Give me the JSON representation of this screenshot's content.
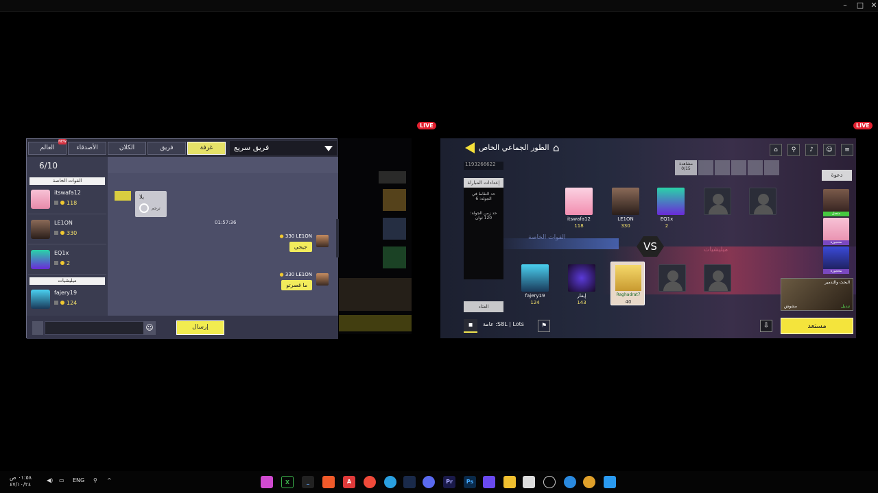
{
  "live_badge": "LIVE",
  "left": {
    "tabs": [
      "العالم",
      "الأصدقاء",
      "الكلان",
      "فريق",
      "غرفة"
    ],
    "active_tab": "غرفة",
    "mode_dropdown": "فريق سريع",
    "player_count": "6/10",
    "teams": [
      {
        "name": "القوات الخاصة",
        "players": [
          {
            "name": "itswafa12",
            "level": "118"
          },
          {
            "name": "LE1ON",
            "level": "330"
          },
          {
            "name": "EQ1x",
            "level": "2"
          }
        ]
      },
      {
        "name": "ميليشيات",
        "players": [
          {
            "name": "fajery19",
            "level": "124"
          }
        ]
      }
    ],
    "system_msg": {
      "text": "يلا",
      "sub": "ترجم"
    },
    "timestamp": "01:57:36",
    "messages": [
      {
        "author": "LE1ON",
        "level": "330",
        "text": "جيجي"
      },
      {
        "author": "LE1ON",
        "level": "330",
        "text": "ما قصرتو"
      }
    ],
    "send_label": "إرسال"
  },
  "right": {
    "title": "الطور الجماعي الخاص",
    "room_id": "1193266622",
    "settings_label": "إعدادات المباراة",
    "settings_items": [
      "حد النقاط في الجولة: 6",
      "حد زمن الجولة: 120 ثوان"
    ],
    "spectators_label": "مشاهدة",
    "spectators_count": "0/15",
    "invite_label": "دعوة",
    "invite_tags": [
      "متصل",
      "محجوزة",
      "محجوزة"
    ],
    "team1_label": "القوات الخاصة",
    "team2_label": "ميليشيات",
    "vs": "VS",
    "team1": [
      {
        "name": "itswafa12",
        "level": "118"
      },
      {
        "name": "LE1ON",
        "level": "330"
      },
      {
        "name": "EQ1x",
        "level": "2"
      }
    ],
    "team2": [
      {
        "name": "fajery19",
        "level": "124"
      },
      {
        "name": "إيفار",
        "level": "143"
      },
      {
        "name": "Raghadrat7",
        "level": "40"
      }
    ],
    "opponent_label": "العتاد",
    "map_name": "مشوش",
    "map_mode": "البحث والتدمير",
    "map_change": "تبديل",
    "chat_channel": "عامة :S8L | Lots",
    "ready_label": "مستعد"
  },
  "taskbar": {
    "time": "٠١:٥٨ ص",
    "date": "٤٧/١٠/٢٤",
    "lang": "ENG"
  }
}
